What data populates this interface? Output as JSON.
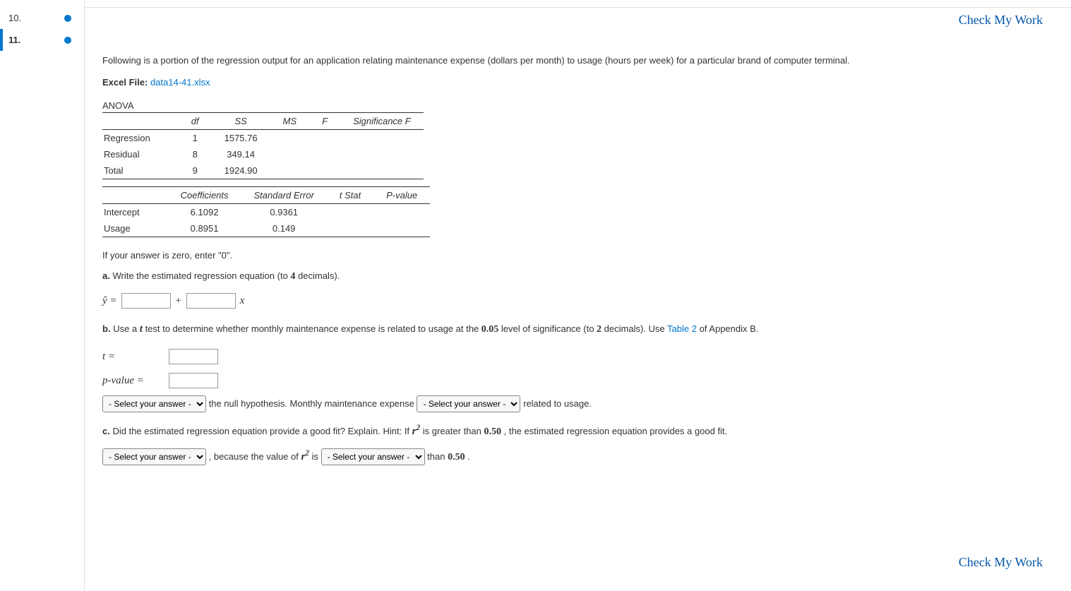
{
  "header": {
    "partial": ""
  },
  "sidebar": {
    "items": [
      {
        "num": "10."
      },
      {
        "num": "11."
      }
    ]
  },
  "checkMyWork": "Check My Work",
  "intro": "Following is a portion of the regression output for an application relating maintenance expense (dollars per month) to usage (hours per week) for a particular brand of computer terminal.",
  "excelLabel": "Excel File:",
  "excelFile": "data14-41.xlsx",
  "anova": {
    "title": "ANOVA",
    "headers": [
      "",
      "df",
      "SS",
      "MS",
      "F",
      "Significance F"
    ],
    "rows": [
      {
        "label": "Regression",
        "df": "1",
        "ss": "1575.76",
        "ms": "",
        "f": "",
        "sig": ""
      },
      {
        "label": "Residual",
        "df": "8",
        "ss": "349.14",
        "ms": "",
        "f": "",
        "sig": ""
      },
      {
        "label": "Total",
        "df": "9",
        "ss": "1924.90",
        "ms": "",
        "f": "",
        "sig": ""
      }
    ]
  },
  "coef": {
    "headers": [
      "",
      "Coefficients",
      "Standard Error",
      "t Stat",
      "P-value"
    ],
    "rows": [
      {
        "label": "Intercept",
        "coef": "6.1092",
        "se": "0.9361",
        "t": "",
        "p": ""
      },
      {
        "label": "Usage",
        "coef": "0.8951",
        "se": "0.149",
        "t": "",
        "p": ""
      }
    ]
  },
  "zeroInstr": "If your answer is zero, enter \"0\".",
  "partA": {
    "prefix": "a.",
    "text": " Write the estimated regression equation (to ",
    "decimals": "4",
    "suffix": " decimals).",
    "yhat": "ŷ =",
    "plus": "+",
    "x": "x"
  },
  "partB": {
    "prefix": "b.",
    "text1": " Use a ",
    "t": "t",
    "text2": " test to determine whether monthly maintenance expense is related to usage at the ",
    "alpha": "0.05",
    "text3": " level of significance (to ",
    "dec": "2",
    "text4": " decimals). Use ",
    "tableLink": "Table 2",
    "text5": " of Appendix B.",
    "tLabel": "t =",
    "pLabel": "p-value =",
    "selPlaceholder": "- Select your answer -",
    "mid1": " the null hypothesis. Monthly maintenance expense ",
    "mid2": " related to usage."
  },
  "partC": {
    "prefix": "c.",
    "text1": " Did the estimated regression equation provide a good fit? Explain. Hint: If ",
    "r2": "r",
    "text2": " is greater than ",
    "thresh": "0.50",
    "text3": ", the estimated regression equation provides a good fit.",
    "comma": " , because the value of ",
    "is": " is ",
    "than": " than ",
    "fifty": "0.50",
    "dot": "."
  }
}
